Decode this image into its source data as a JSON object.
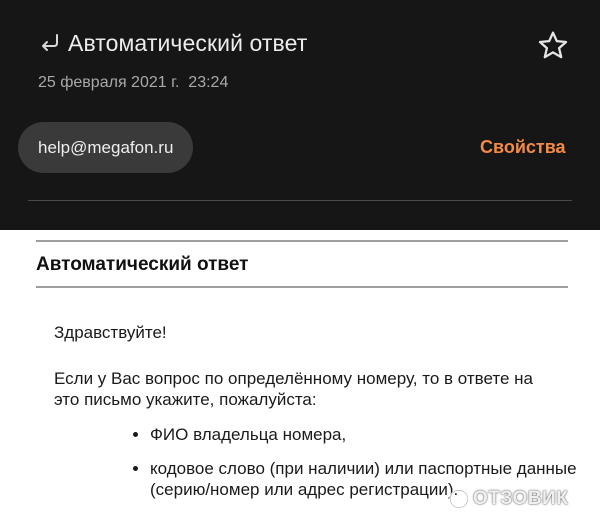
{
  "message": {
    "subject": "Автоматический ответ",
    "date": "25 февраля 2021 г.  23:24",
    "sender": "help@megafon.ru",
    "properties_label": "Свойства"
  },
  "body": {
    "title": "Автоматический ответ",
    "greeting": "Здравствуйте!",
    "paragraph": "Если у Вас вопрос по определённому номеру, то в ответе на это письмо укажите, пожалуйста:",
    "list_items": [
      "ФИО владельца номера,",
      "кодовое слово (при наличии) или паспортные данные (серию/номер или адрес регистрации)."
    ]
  },
  "watermark": {
    "text": "ОТЗОВИК"
  },
  "colors": {
    "header_bg": "#161616",
    "accent": "#f28a48",
    "chip_bg": "#3a3a3a"
  },
  "icons": {
    "reply": "reply-arrow-icon",
    "star": "star-outline-icon"
  }
}
